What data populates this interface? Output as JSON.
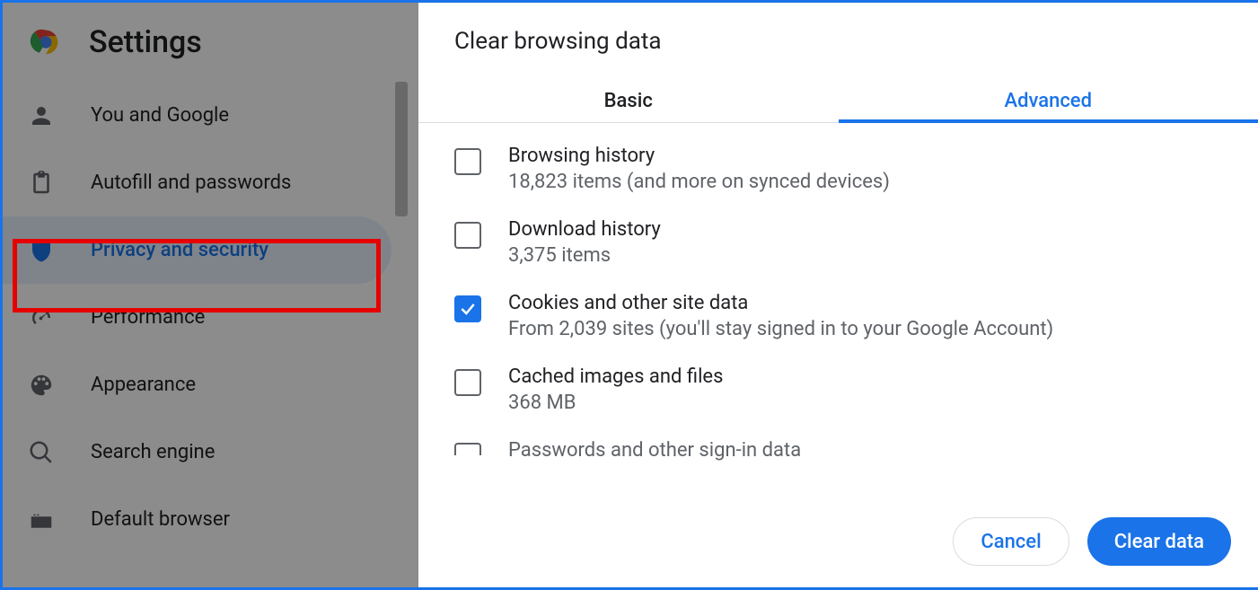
{
  "header": {
    "title": "Settings"
  },
  "sidebar": {
    "items": [
      {
        "label": "You and Google"
      },
      {
        "label": "Autofill and passwords"
      },
      {
        "label": "Privacy and security"
      },
      {
        "label": "Performance"
      },
      {
        "label": "Appearance"
      },
      {
        "label": "Search engine"
      },
      {
        "label": "Default browser"
      }
    ],
    "active_index": 2
  },
  "dialog": {
    "title": "Clear browsing data",
    "tabs": {
      "basic": "Basic",
      "advanced": "Advanced",
      "active": "advanced"
    },
    "options": [
      {
        "title": "Browsing history",
        "sub": "18,823 items (and more on synced devices)",
        "checked": false
      },
      {
        "title": "Download history",
        "sub": "3,375 items",
        "checked": false
      },
      {
        "title": "Cookies and other site data",
        "sub": "From 2,039 sites (you'll stay signed in to your Google Account)",
        "checked": true
      },
      {
        "title": "Cached images and files",
        "sub": "368 MB",
        "checked": false
      },
      {
        "title": "Passwords and other sign-in data",
        "sub": "",
        "checked": false
      }
    ],
    "actions": {
      "cancel": "Cancel",
      "clear": "Clear data"
    }
  },
  "annotations": {
    "highlight_sidebar_index": 2
  }
}
